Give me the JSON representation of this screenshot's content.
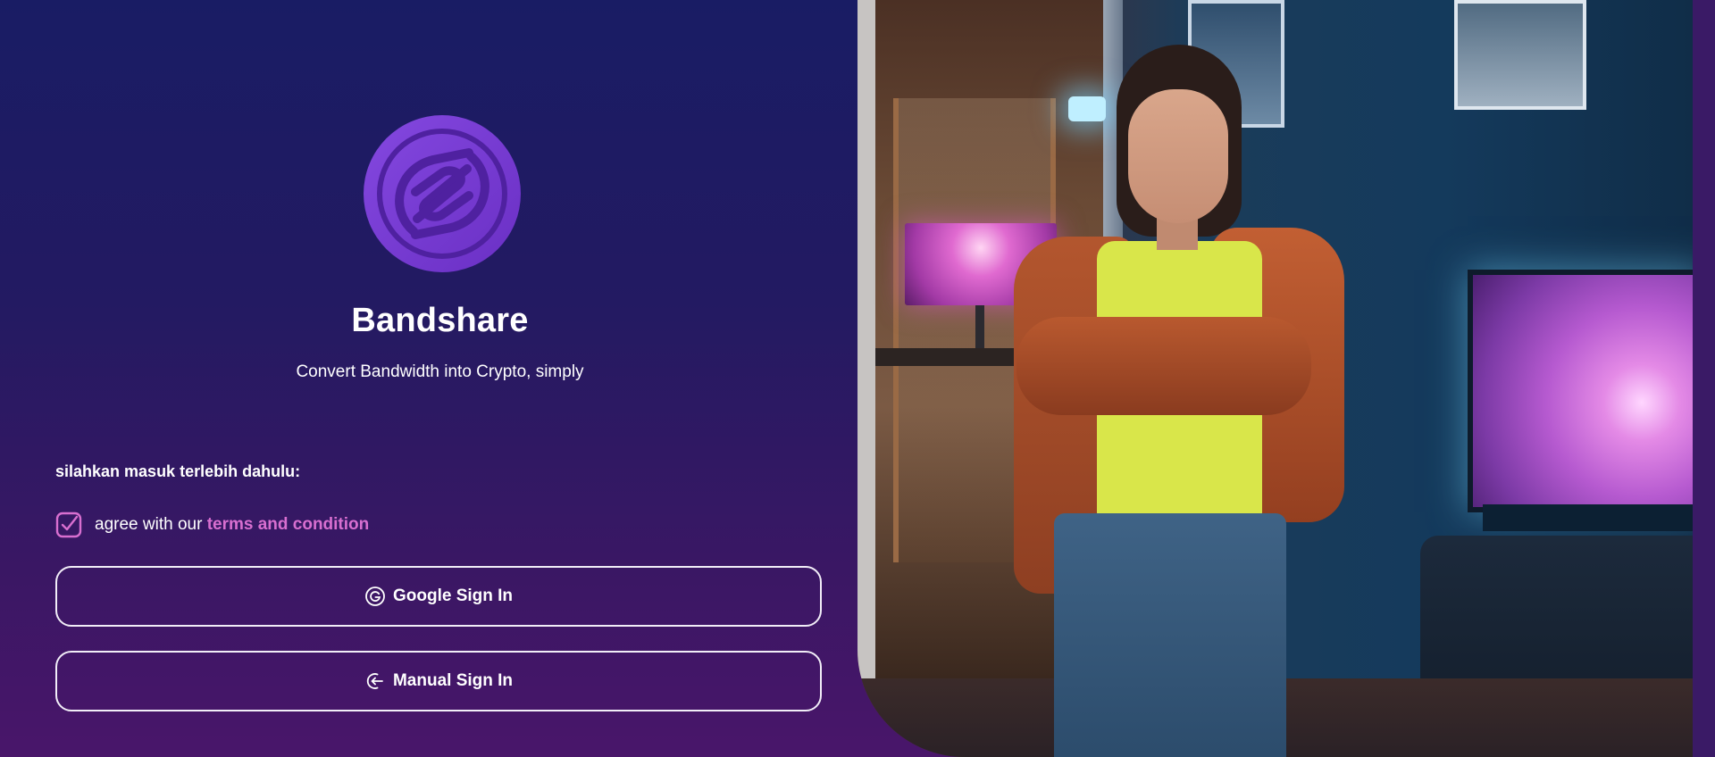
{
  "brand": {
    "name": "Bandshare",
    "tagline": "Convert Bandwidth into Crypto, simply",
    "logo_icon": "bandshare-logo-icon",
    "accent_color": "#7a3fd6"
  },
  "login": {
    "prompt": "silahkan masuk terlebih dahulu:",
    "agree_prefix": "agree with our ",
    "terms_link": "terms and condition",
    "agree_checked": true,
    "checkbox_color": "#d86fd0",
    "buttons": {
      "google": {
        "label": "Google Sign In",
        "icon": "google-icon"
      },
      "manual": {
        "label": "Manual Sign In",
        "icon": "login-icon"
      }
    }
  },
  "hero": {
    "image": "hero-photo"
  }
}
